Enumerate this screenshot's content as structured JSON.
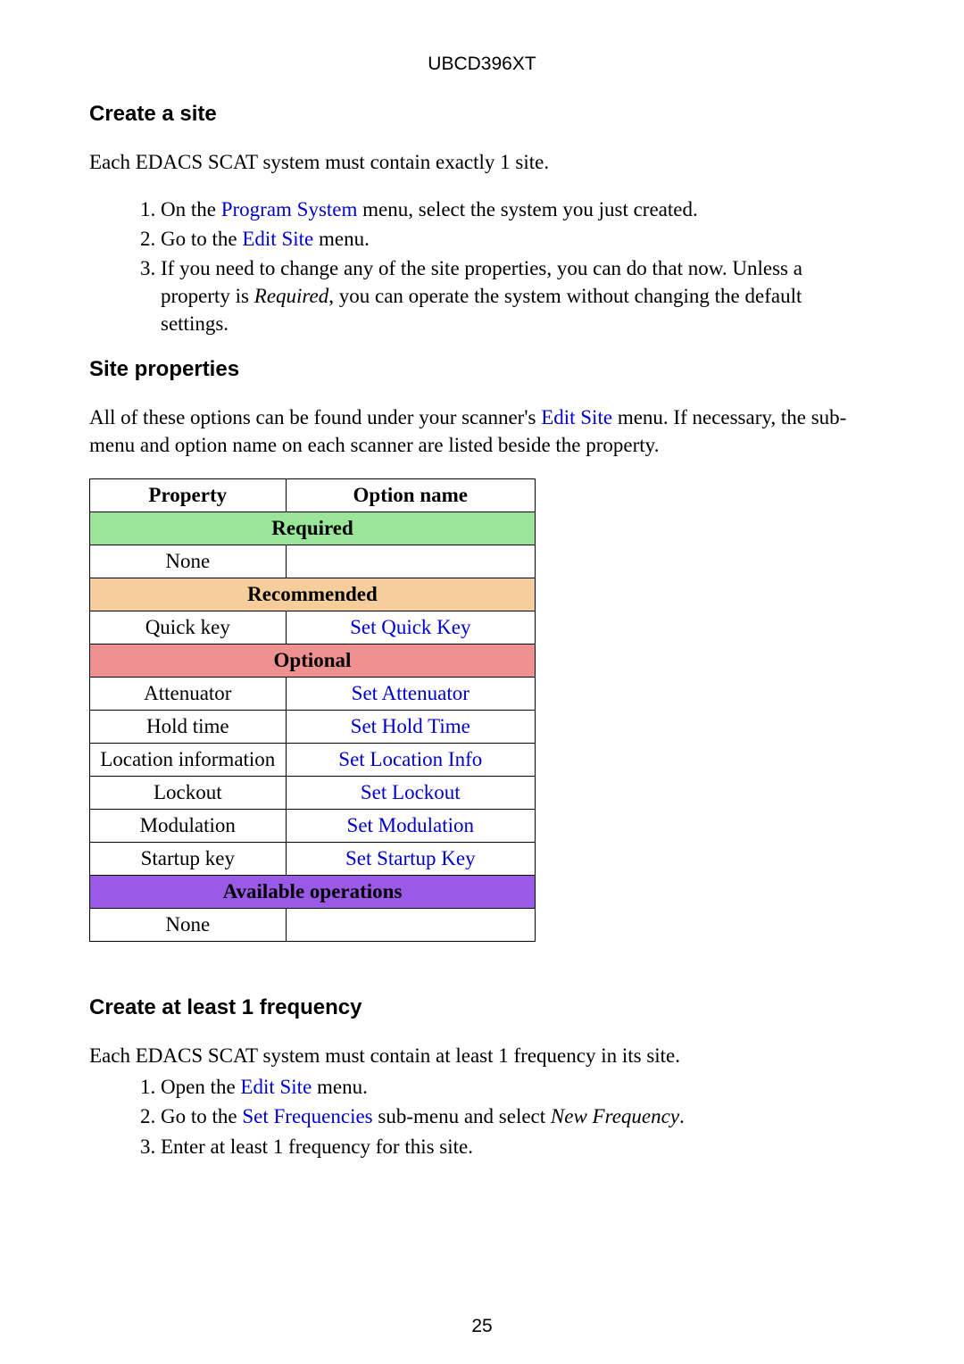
{
  "doc_header": "UBCD396XT",
  "page_number": "25",
  "section1": {
    "heading": "Create a site",
    "intro": "Each EDACS SCAT system must contain exactly 1 site.",
    "list": {
      "i1_pre": "On the ",
      "i1_link": "Program System",
      "i1_post": " menu, select the system you just created.",
      "i2_pre": "Go to the ",
      "i2_link": "Edit Site",
      "i2_post": " menu.",
      "i3_pre": "If you need to change any of the site properties, you can do that now. Unless a property is ",
      "i3_em": "Required",
      "i3_post": ", you can operate the system without changing the default settings."
    }
  },
  "section2": {
    "heading": "Site properties",
    "intro_pre": "All of these options can be found under your scanner's ",
    "intro_link": "Edit Site",
    "intro_post": " menu. If necessary, the sub-menu and option name on each scanner are listed beside the property."
  },
  "table": {
    "head_property": "Property",
    "head_option": "Option name",
    "sec_required": "Required",
    "required_none": "None",
    "sec_recommended": "Recommended",
    "rec_prop_1": "Quick key",
    "rec_opt_1": "Set Quick Key",
    "sec_optional": "Optional",
    "opt_rows": [
      {
        "prop": "Attenuator",
        "opt": "Set Attenuator"
      },
      {
        "prop": "Hold time",
        "opt": "Set Hold Time"
      },
      {
        "prop": "Location information",
        "opt": "Set Location Info"
      },
      {
        "prop": "Lockout",
        "opt": "Set Lockout"
      },
      {
        "prop": "Modulation",
        "opt": "Set Modulation"
      },
      {
        "prop": "Startup key",
        "opt": "Set Startup Key"
      }
    ],
    "sec_available": "Available operations",
    "avail_none": "None"
  },
  "section3": {
    "heading": "Create at least 1 frequency",
    "intro": "Each EDACS SCAT system must contain at least 1 frequency in its site.",
    "list": {
      "i1_pre": "Open the ",
      "i1_link": "Edit Site",
      "i1_post": " menu.",
      "i2_pre": "Go to the ",
      "i2_link": "Set Frequencies",
      "i2_mid": " sub-menu and select ",
      "i2_em": "New Frequency",
      "i2_post": ".",
      "i3": "Enter at least 1 frequency for this site."
    }
  }
}
